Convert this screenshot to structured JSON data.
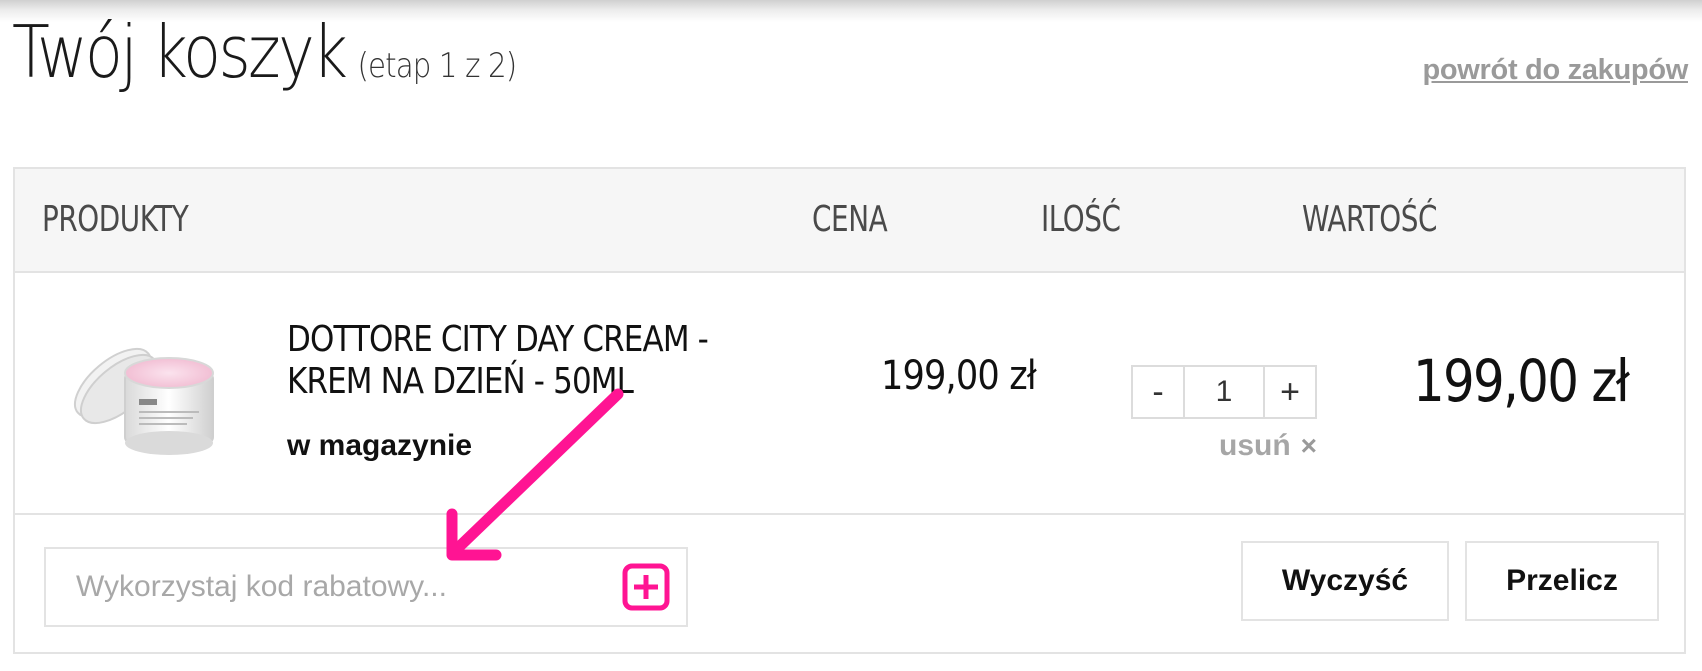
{
  "header": {
    "title": "Twój koszyk",
    "step": "(etap 1 z 2)",
    "back_link": "powrót do zakupów"
  },
  "table": {
    "columns": {
      "products": "PRODUKTY",
      "price": "CENA",
      "quantity": "ILOŚĆ",
      "value": "WARTOŚĆ"
    }
  },
  "item": {
    "name": "DOTTORE CITY DAY CREAM - KREM NA DZIEŃ - 50ML",
    "stock": "w magazynie",
    "price": "199,00 zł",
    "qty_minus": "-",
    "quantity": "1",
    "qty_plus": "+",
    "remove": "usuń",
    "remove_icon": "×",
    "total": "199,00 zł"
  },
  "coupon": {
    "placeholder": "Wykorzystaj kod rabatowy..."
  },
  "actions": {
    "clear": "Wyczyść",
    "recalculate": "Przelicz"
  },
  "colors": {
    "accent": "#ff1493",
    "header_bg": "#f6f6f6",
    "border": "#e3e3e3",
    "link": "#9a9a9a"
  }
}
